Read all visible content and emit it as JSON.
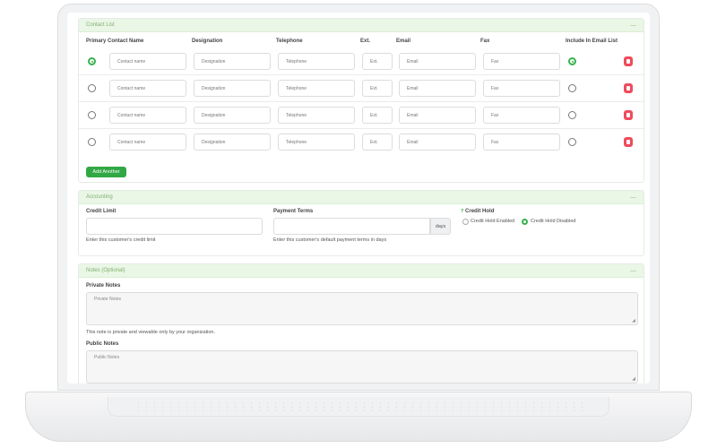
{
  "contact_list": {
    "title": "Contact List",
    "collapse_symbol": "—",
    "headers": {
      "primary_contact": "Primary Contact Name",
      "designation": "Designation",
      "telephone": "Telephone",
      "ext": "Ext.",
      "email": "Email",
      "fax": "Fax",
      "include_email": "Include In Email List"
    },
    "placeholders": {
      "name": "Contact name",
      "designation": "Designation",
      "telephone": "Telephone",
      "ext": "Ext.",
      "email": "Email",
      "fax": "Fax"
    },
    "rows": [
      {
        "primary": true,
        "include": true
      },
      {
        "primary": false,
        "include": false
      },
      {
        "primary": false,
        "include": false
      },
      {
        "primary": false,
        "include": false
      }
    ],
    "add_button": "Add Another"
  },
  "accounting": {
    "title": "Accounting",
    "collapse_symbol": "—",
    "credit_limit_label": "Credit Limit",
    "credit_limit_hint": "Enter this customer's credit limit",
    "payment_terms_label": "Payment Terms",
    "payment_terms_addon": "days",
    "payment_terms_hint": "Enter this customer's default payment terms in days",
    "credit_hold_icon": "?",
    "credit_hold_label": "Credit Hold",
    "credit_hold_enabled": "Credit Hold Enabled",
    "credit_hold_disabled": "Credit Hold Disabled",
    "credit_hold_selected": "disabled"
  },
  "notes": {
    "title": "Notes (Optional)",
    "collapse_symbol": "—",
    "private_label": "Private Notes",
    "private_placeholder": "Private Notes",
    "private_hint": "This note is private and viewable only by your organization.",
    "public_label": "Public Notes",
    "public_placeholder": "Public Notes"
  },
  "colors": {
    "accent": "#37b24d",
    "section_header_bg": "#eaf6e6",
    "delete": "#f04b5c"
  }
}
